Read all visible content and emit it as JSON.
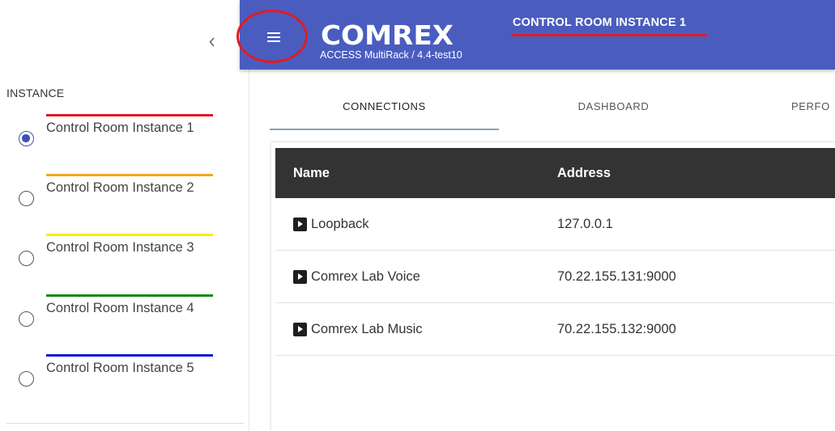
{
  "app": {
    "brand": "COMREX",
    "product": "ACCESS MultiRack / 4.4-test10",
    "instance_title": "CONTROL ROOM INSTANCE 1"
  },
  "sidebar": {
    "collapse_icon": "chevron-left-icon",
    "section_title": "INSTANCE",
    "instances": [
      {
        "label": "Control Room Instance 1",
        "color": "#e01b24",
        "selected": true
      },
      {
        "label": "Control Room Instance 2",
        "color": "#f0a81e",
        "selected": false
      },
      {
        "label": "Control Room Instance 3",
        "color": "#f5f000",
        "selected": false
      },
      {
        "label": "Control Room Instance 4",
        "color": "#138a13",
        "selected": false
      },
      {
        "label": "Control Room Instance 5",
        "color": "#1414d6",
        "selected": false
      }
    ]
  },
  "tabs": [
    {
      "label": "CONNECTIONS",
      "active": true
    },
    {
      "label": "DASHBOARD",
      "active": false
    },
    {
      "label": "PERFO",
      "active": false
    }
  ],
  "connections": {
    "columns": [
      "Name",
      "Address"
    ],
    "rows": [
      {
        "name": "Loopback",
        "address": "127.0.0.1"
      },
      {
        "name": "Comrex Lab Voice",
        "address": "70.22.155.131:9000"
      },
      {
        "name": "Comrex Lab Music",
        "address": "70.22.155.132:9000"
      }
    ]
  },
  "colors": {
    "topbar": "#4a5dbf",
    "accent": "#3f51b5",
    "annotation": "#e01b24",
    "table_header": "#333333"
  }
}
